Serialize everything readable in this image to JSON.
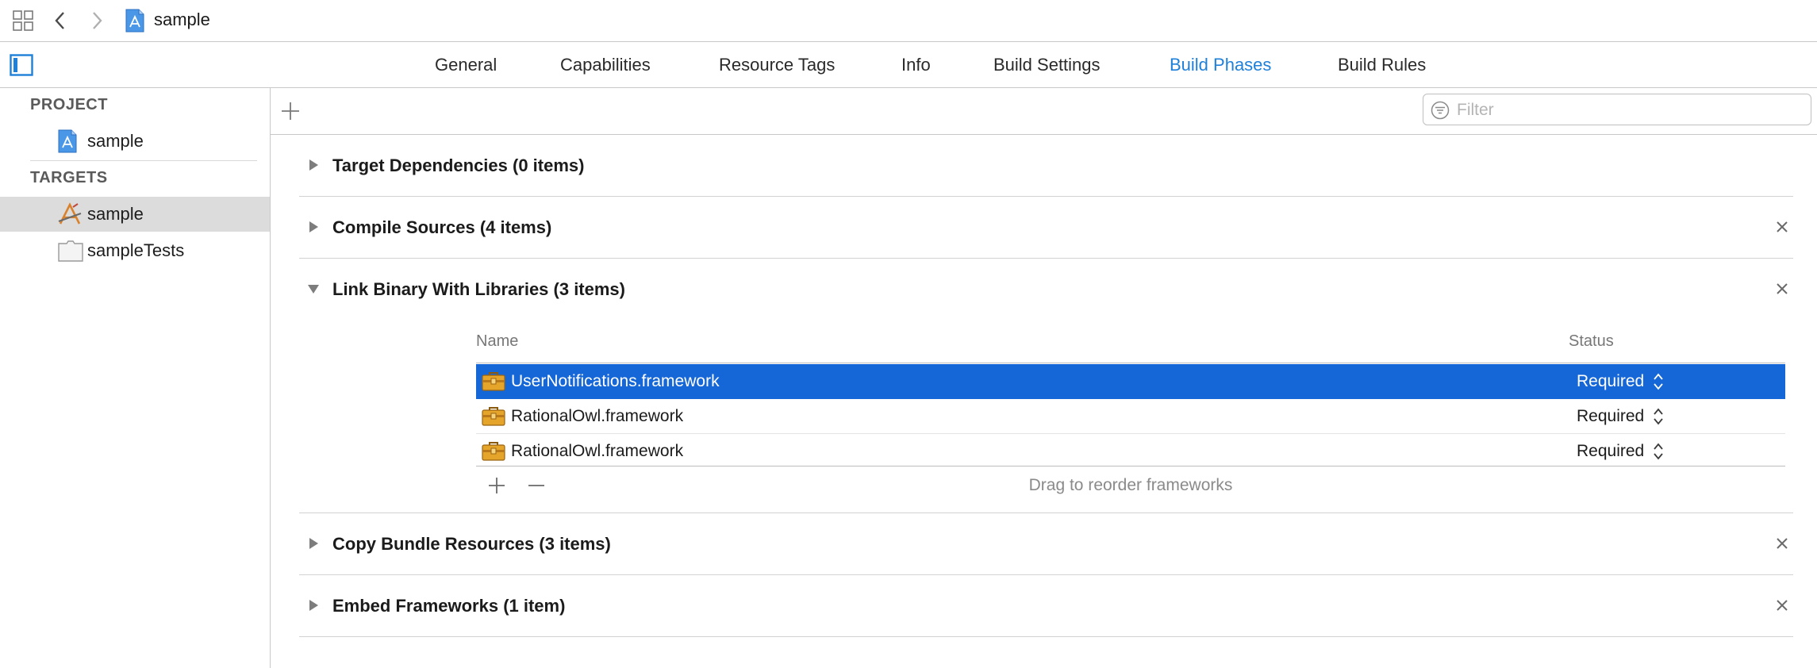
{
  "jumpbar": {
    "project_title": "sample"
  },
  "tabs": [
    {
      "label": "General"
    },
    {
      "label": "Capabilities"
    },
    {
      "label": "Resource Tags"
    },
    {
      "label": "Info"
    },
    {
      "label": "Build Settings"
    },
    {
      "label": "Build Phases",
      "active": true
    },
    {
      "label": "Build Rules"
    }
  ],
  "sidebar": {
    "project_header": "PROJECT",
    "project_item": "sample",
    "targets_header": "TARGETS",
    "targets": [
      {
        "label": "sample",
        "selected": true
      },
      {
        "label": "sampleTests"
      }
    ]
  },
  "filter": {
    "placeholder": "Filter",
    "value": ""
  },
  "phases": [
    {
      "title": "Target Dependencies (0 items)",
      "expanded": false,
      "closable": false
    },
    {
      "title": "Compile Sources (4 items)",
      "expanded": false,
      "closable": true
    },
    {
      "title": "Link Binary With Libraries (3 items)",
      "expanded": true,
      "closable": true
    },
    {
      "title": "Copy Bundle Resources (3 items)",
      "expanded": false,
      "closable": true
    },
    {
      "title": "Embed Frameworks (1 item)",
      "expanded": false,
      "closable": true
    }
  ],
  "libraries": {
    "columns": {
      "name": "Name",
      "status": "Status"
    },
    "rows": [
      {
        "name": "UserNotifications.framework",
        "status": "Required",
        "selected": true
      },
      {
        "name": "RationalOwl.framework",
        "status": "Required"
      },
      {
        "name": "RationalOwl.framework",
        "status": "Required"
      }
    ],
    "footer_hint": "Drag to reorder frameworks"
  },
  "colors": {
    "accent": "#1f80d9",
    "selection": "#1566d6",
    "sidebar_selection": "#dcdcdc"
  }
}
